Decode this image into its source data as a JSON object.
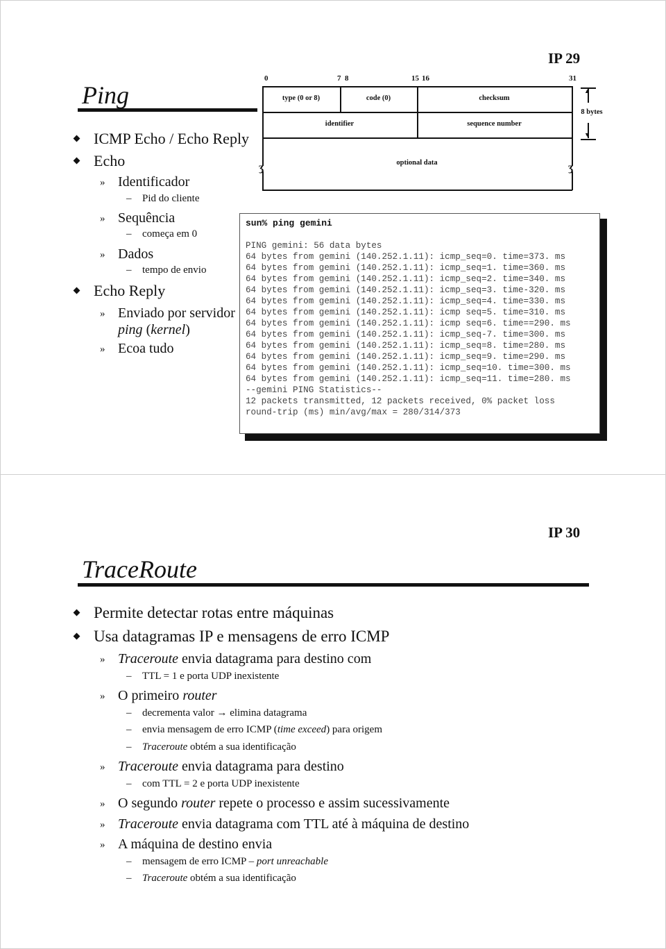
{
  "slide1": {
    "number": "IP 29",
    "title": "Ping",
    "bullets": {
      "b1": "ICMP Echo / Echo Reply",
      "b2": "Echo",
      "b2_1": "Identificador",
      "b2_1_1": "Pid do cliente",
      "b2_2": "Sequência",
      "b2_2_1": "começa em 0",
      "b2_3": "Dados",
      "b2_3_1": "tempo de envio",
      "b3": "Echo Reply",
      "b3_1": "Enviado por servidor",
      "b3_1_cont_a": "ping",
      "b3_1_cont_b": " (",
      "b3_1_cont_c": "kernel",
      "b3_1_cont_d": ")",
      "b3_2": "Ecoa tudo"
    },
    "diagram": {
      "bits": {
        "b0": "0",
        "b7": "7",
        "b8": "8",
        "b15": "15",
        "b16": "16",
        "b31": "31"
      },
      "fields": {
        "type": "type (0 or 8)",
        "code": "code (0)",
        "checksum": "checksum",
        "identifier": "identifier",
        "sequence": "sequence number",
        "optional": "optional data"
      },
      "size_label": "8 bytes"
    },
    "terminal": {
      "command": "sun% ping gemini",
      "lines": [
        "PING gemini: 56 data bytes",
        "64 bytes from gemini (140.252.1.11): icmp_seq=0. time=373. ms",
        "64 bytes from gemini (140.252.1.11): icmp_seq=1. time=360. ms",
        "64 bytes from gemini (140.252.1.11): icmp_seq=2. time=340. ms",
        "64 bytes from gemini (140.252.1.11): icmp_seq=3. time-320. ms",
        "64 bytes from gemini (140.252.1.11): icmp_seq=4. time=330. ms",
        "64 bytes from gemini (140.252.1.11): icmp seq=5. time=310. ms",
        "64 bytes from gemini (140.252.1.11): icmp seq=6. time==290. ms",
        "64 bytes from gemini (140.252.1.11): icmp_seq-7. time=300. ms",
        "64 bytes from gemini (140.252.1.11): icmp_seq=8. time=280. ms",
        "64 bytes from gemini (140.252.1.11): icmp_seq=9. time=290. ms",
        "64 bytes from gemini (140.252.1.11): icmp_seq=10. time=300. ms",
        "64 bytes from gemini (140.252.1.11): icmp_seq=11. time=280. ms",
        "--gemini PING Statistics--",
        "12 packets transmitted, 12 packets received, 0% packet loss",
        "round-trip (ms) min/avg/max = 280/314/373"
      ]
    }
  },
  "slide2": {
    "number": "IP 30",
    "title": "TraceRoute",
    "bullets": {
      "b1": "Permite detectar rotas entre máquinas",
      "b2": "Usa datagramas IP e mensagens de erro ICMP",
      "s1_it": "Traceroute",
      "s1_rest": " envia datagrama para destino com",
      "s1_1": "TTL = 1 e porta UDP inexistente",
      "s2_a": "O primeiro ",
      "s2_it": "router",
      "s2_1": "decrementa valor → elimina datagrama",
      "s2_2_a": "envia mensagem de erro ICMP (",
      "s2_2_it": "time exceed",
      "s2_2_b": ") para origem",
      "s2_3_it": "Traceroute",
      "s2_3_rest": " obtém a sua identificação",
      "s3_it": "Traceroute",
      "s3_rest": " envia datagrama para destino",
      "s3_1": "com TTL = 2 e porta UDP inexistente",
      "s4_a": "O segundo ",
      "s4_it": "router",
      "s4_b": " repete o processo e assim sucessivamente",
      "s5_it": "Traceroute",
      "s5_rest": " envia datagrama com TTL até à máquina de destino",
      "s6": "A máquina de destino envia",
      "s6_1_a": "mensagem de erro ICMP – ",
      "s6_1_it": "port unreachable",
      "s6_2_it": "Traceroute",
      "s6_2_rest": " obtém a sua identificação"
    }
  }
}
